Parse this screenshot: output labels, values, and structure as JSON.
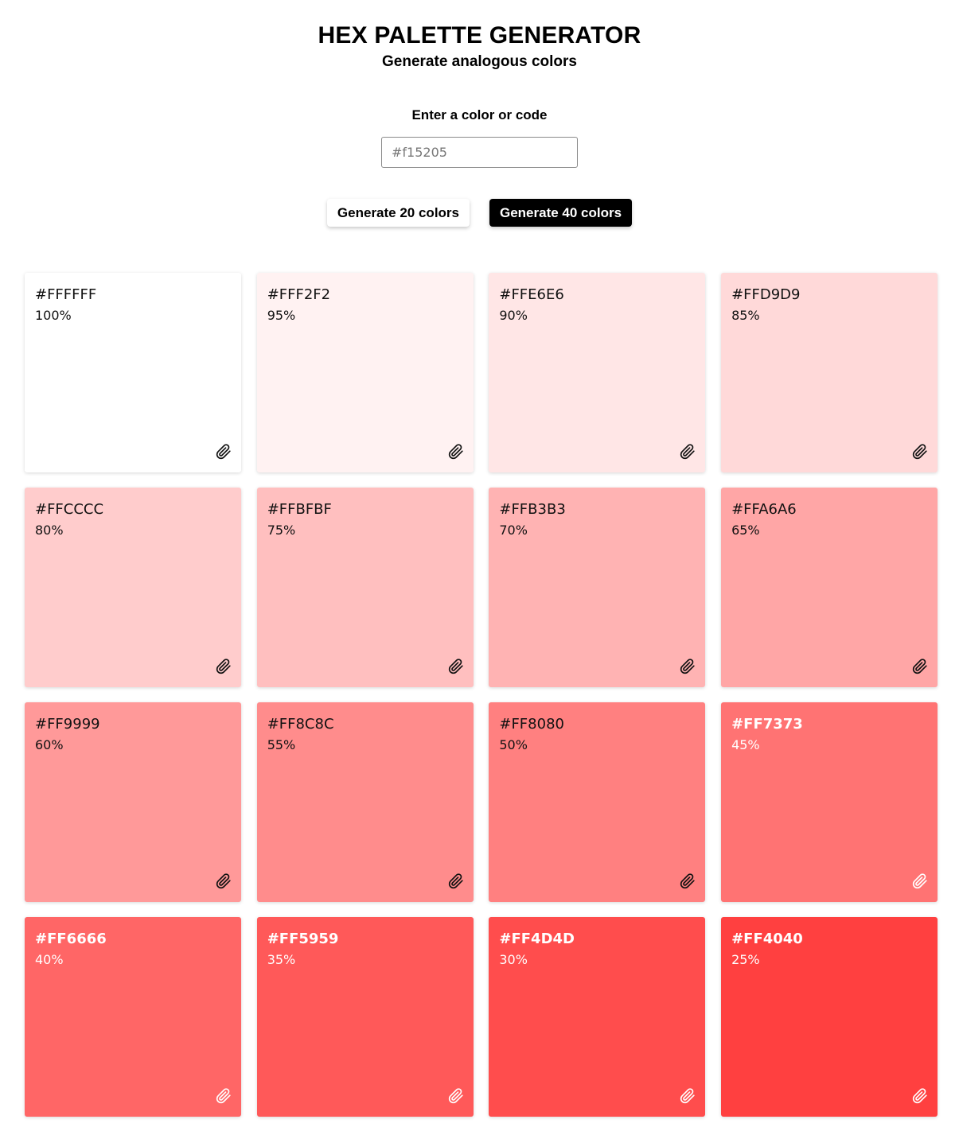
{
  "header": {
    "title": "HEX PALETTE GENERATOR",
    "subtitle": "Generate analogous colors"
  },
  "input": {
    "label": "Enter a color or code",
    "placeholder": "#f15205",
    "value": ""
  },
  "buttons": {
    "generate_20": "Generate 20 colors",
    "generate_40": "Generate 40 colors"
  },
  "icons": {
    "copy": "paperclip-icon"
  },
  "swatches": [
    {
      "hex": "#FFFFFF",
      "percent": "100%",
      "text": "dark"
    },
    {
      "hex": "#FFF2F2",
      "percent": "95%",
      "text": "dark"
    },
    {
      "hex": "#FFE6E6",
      "percent": "90%",
      "text": "dark"
    },
    {
      "hex": "#FFD9D9",
      "percent": "85%",
      "text": "dark"
    },
    {
      "hex": "#FFCCCC",
      "percent": "80%",
      "text": "dark"
    },
    {
      "hex": "#FFBFBF",
      "percent": "75%",
      "text": "dark"
    },
    {
      "hex": "#FFB3B3",
      "percent": "70%",
      "text": "dark"
    },
    {
      "hex": "#FFA6A6",
      "percent": "65%",
      "text": "dark"
    },
    {
      "hex": "#FF9999",
      "percent": "60%",
      "text": "dark"
    },
    {
      "hex": "#FF8C8C",
      "percent": "55%",
      "text": "dark"
    },
    {
      "hex": "#FF8080",
      "percent": "50%",
      "text": "dark"
    },
    {
      "hex": "#FF7373",
      "percent": "45%",
      "text": "light"
    },
    {
      "hex": "#FF6666",
      "percent": "40%",
      "text": "light"
    },
    {
      "hex": "#FF5959",
      "percent": "35%",
      "text": "light"
    },
    {
      "hex": "#FF4D4D",
      "percent": "30%",
      "text": "light"
    },
    {
      "hex": "#FF4040",
      "percent": "25%",
      "text": "light"
    }
  ]
}
